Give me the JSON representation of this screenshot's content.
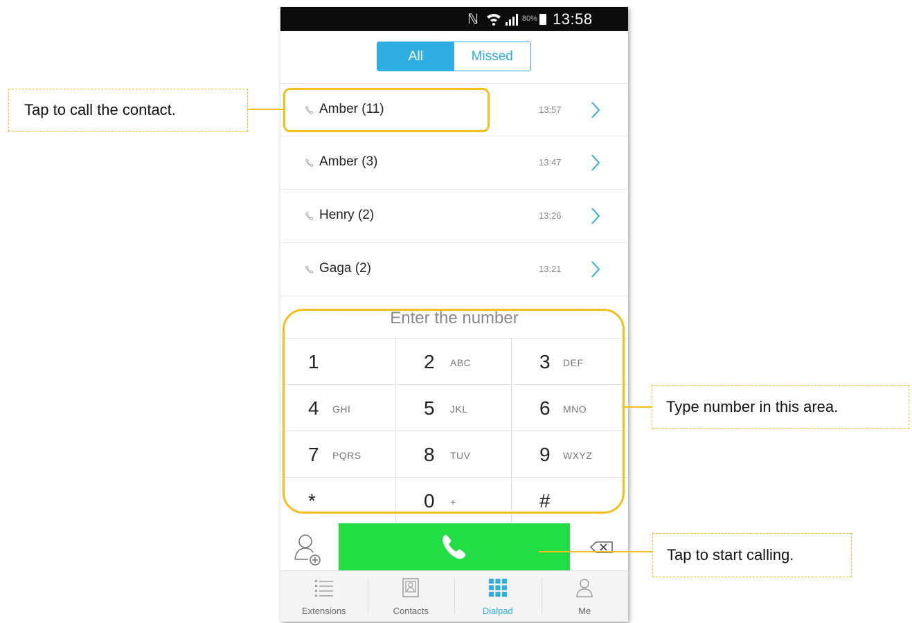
{
  "status_bar": {
    "n_glyph": "ℕ",
    "battery_text": "80%",
    "time": "13:58"
  },
  "segment": {
    "tabs": [
      {
        "label": "All",
        "active": true
      },
      {
        "label": "Missed",
        "active": false
      }
    ]
  },
  "calls": [
    {
      "name": "Amber (11)",
      "time": "13:57"
    },
    {
      "name": "Amber (3)",
      "time": "13:47"
    },
    {
      "name": "Henry (2)",
      "time": "13:26"
    },
    {
      "name": "Gaga (2)",
      "time": "13:21"
    }
  ],
  "dialpad": {
    "placeholder": "Enter the number",
    "keys": [
      {
        "digit": "1",
        "letters": ""
      },
      {
        "digit": "2",
        "letters": "ABC"
      },
      {
        "digit": "3",
        "letters": "DEF"
      },
      {
        "digit": "4",
        "letters": "GHI"
      },
      {
        "digit": "5",
        "letters": "JKL"
      },
      {
        "digit": "6",
        "letters": "MNO"
      },
      {
        "digit": "7",
        "letters": "PQRS"
      },
      {
        "digit": "8",
        "letters": "TUV"
      },
      {
        "digit": "9",
        "letters": "WXYZ"
      },
      {
        "digit": "*",
        "letters": ""
      },
      {
        "digit": "0",
        "letters": "+"
      },
      {
        "digit": "#",
        "letters": ""
      }
    ]
  },
  "bottom_nav": {
    "items": [
      {
        "label": "Extensions",
        "icon": "list-icon"
      },
      {
        "label": "Contacts",
        "icon": "contact-book-icon"
      },
      {
        "label": "Dialpad",
        "icon": "dialpad-icon",
        "active": true
      },
      {
        "label": "Me",
        "icon": "person-icon"
      }
    ]
  },
  "callouts": {
    "contact": "Tap to call the contact.",
    "type_number": "Type number in this area.",
    "start_call": "Tap to start calling."
  },
  "colors": {
    "accent": "#2eaee2",
    "call_button": "#22dd44",
    "highlight": "#f5be1a"
  }
}
